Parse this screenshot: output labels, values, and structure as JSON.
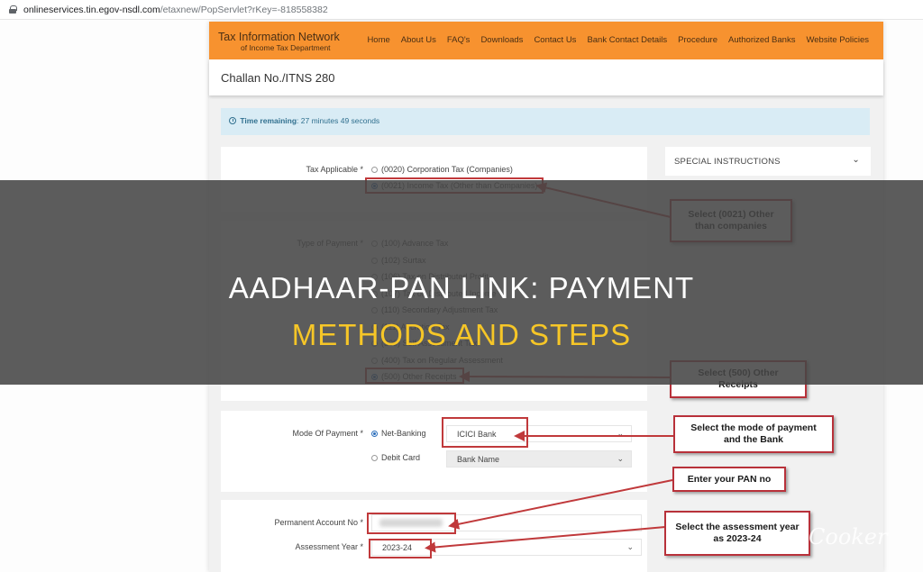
{
  "browser": {
    "url_host": "onlineservices.tin.egov-nsdl.com",
    "url_path": "/etaxnew/PopServlet?rKey=-818558382"
  },
  "header": {
    "brand_title": "Tax Information Network",
    "brand_subtitle": "of Income Tax Department",
    "nav": [
      "Home",
      "About Us",
      "FAQ's",
      "Downloads",
      "Contact Us",
      "Bank Contact Details",
      "Procedure",
      "Authorized Banks",
      "Website Policies"
    ],
    "accent_color": "#f7922f"
  },
  "page_title": "Challan No./ITNS 280",
  "timer": {
    "label": "Time remaining",
    "value": ": 27 minutes 49 seconds"
  },
  "special_instructions": {
    "label": "SPECIAL INSTRUCTIONS"
  },
  "form": {
    "tax_applicable": {
      "label": "Tax Applicable *",
      "options": [
        {
          "label": "(0020) Corporation Tax (Companies)",
          "checked": false
        },
        {
          "label": "(0021) Income Tax (Other than Companies)",
          "checked": true
        }
      ]
    },
    "type_of_payment": {
      "label": "Type of Payment *",
      "options": [
        {
          "label": "(100) Advance Tax",
          "checked": false
        },
        {
          "label": "(102) Surtax",
          "checked": false
        },
        {
          "label": "(106) Tax on Distributed Profit",
          "checked": false
        },
        {
          "label": "(107) Tax on Distributed Income",
          "checked": false
        },
        {
          "label": "(110) Secondary Adjustment Tax",
          "checked": false
        },
        {
          "label": "(111) Accretion Tax",
          "checked": false
        },
        {
          "label": "(300) Self Assessment Tax",
          "checked": false
        },
        {
          "label": "(400) Tax on Regular Assessment",
          "checked": false
        },
        {
          "label": "(500) Other Receipts",
          "checked": true
        }
      ]
    },
    "mode_of_payment": {
      "label": "Mode Of Payment *",
      "net_banking": {
        "label": "Net-Banking",
        "checked": true,
        "bank_selected": "ICICI Bank"
      },
      "debit_card": {
        "label": "Debit Card",
        "checked": false,
        "bank_placeholder": "Bank Name"
      }
    },
    "pan": {
      "label": "Permanent Account No *",
      "value": ""
    },
    "assessment_year": {
      "label": "Assessment Year *",
      "value": "2023-24"
    }
  },
  "callouts": [
    "Select (0021) Other than companies",
    "Select (500) Other Receipts",
    "Select the mode of payment and the Bank",
    "Enter your PAN no",
    "Select the assessment year as 2023-24"
  ],
  "overlay": {
    "line1": "AADHAAR-PAN LINK: PAYMENT",
    "line2": "METHODS AND STEPS",
    "line2_color": "#f6c627"
  },
  "watermark": "Cooker"
}
